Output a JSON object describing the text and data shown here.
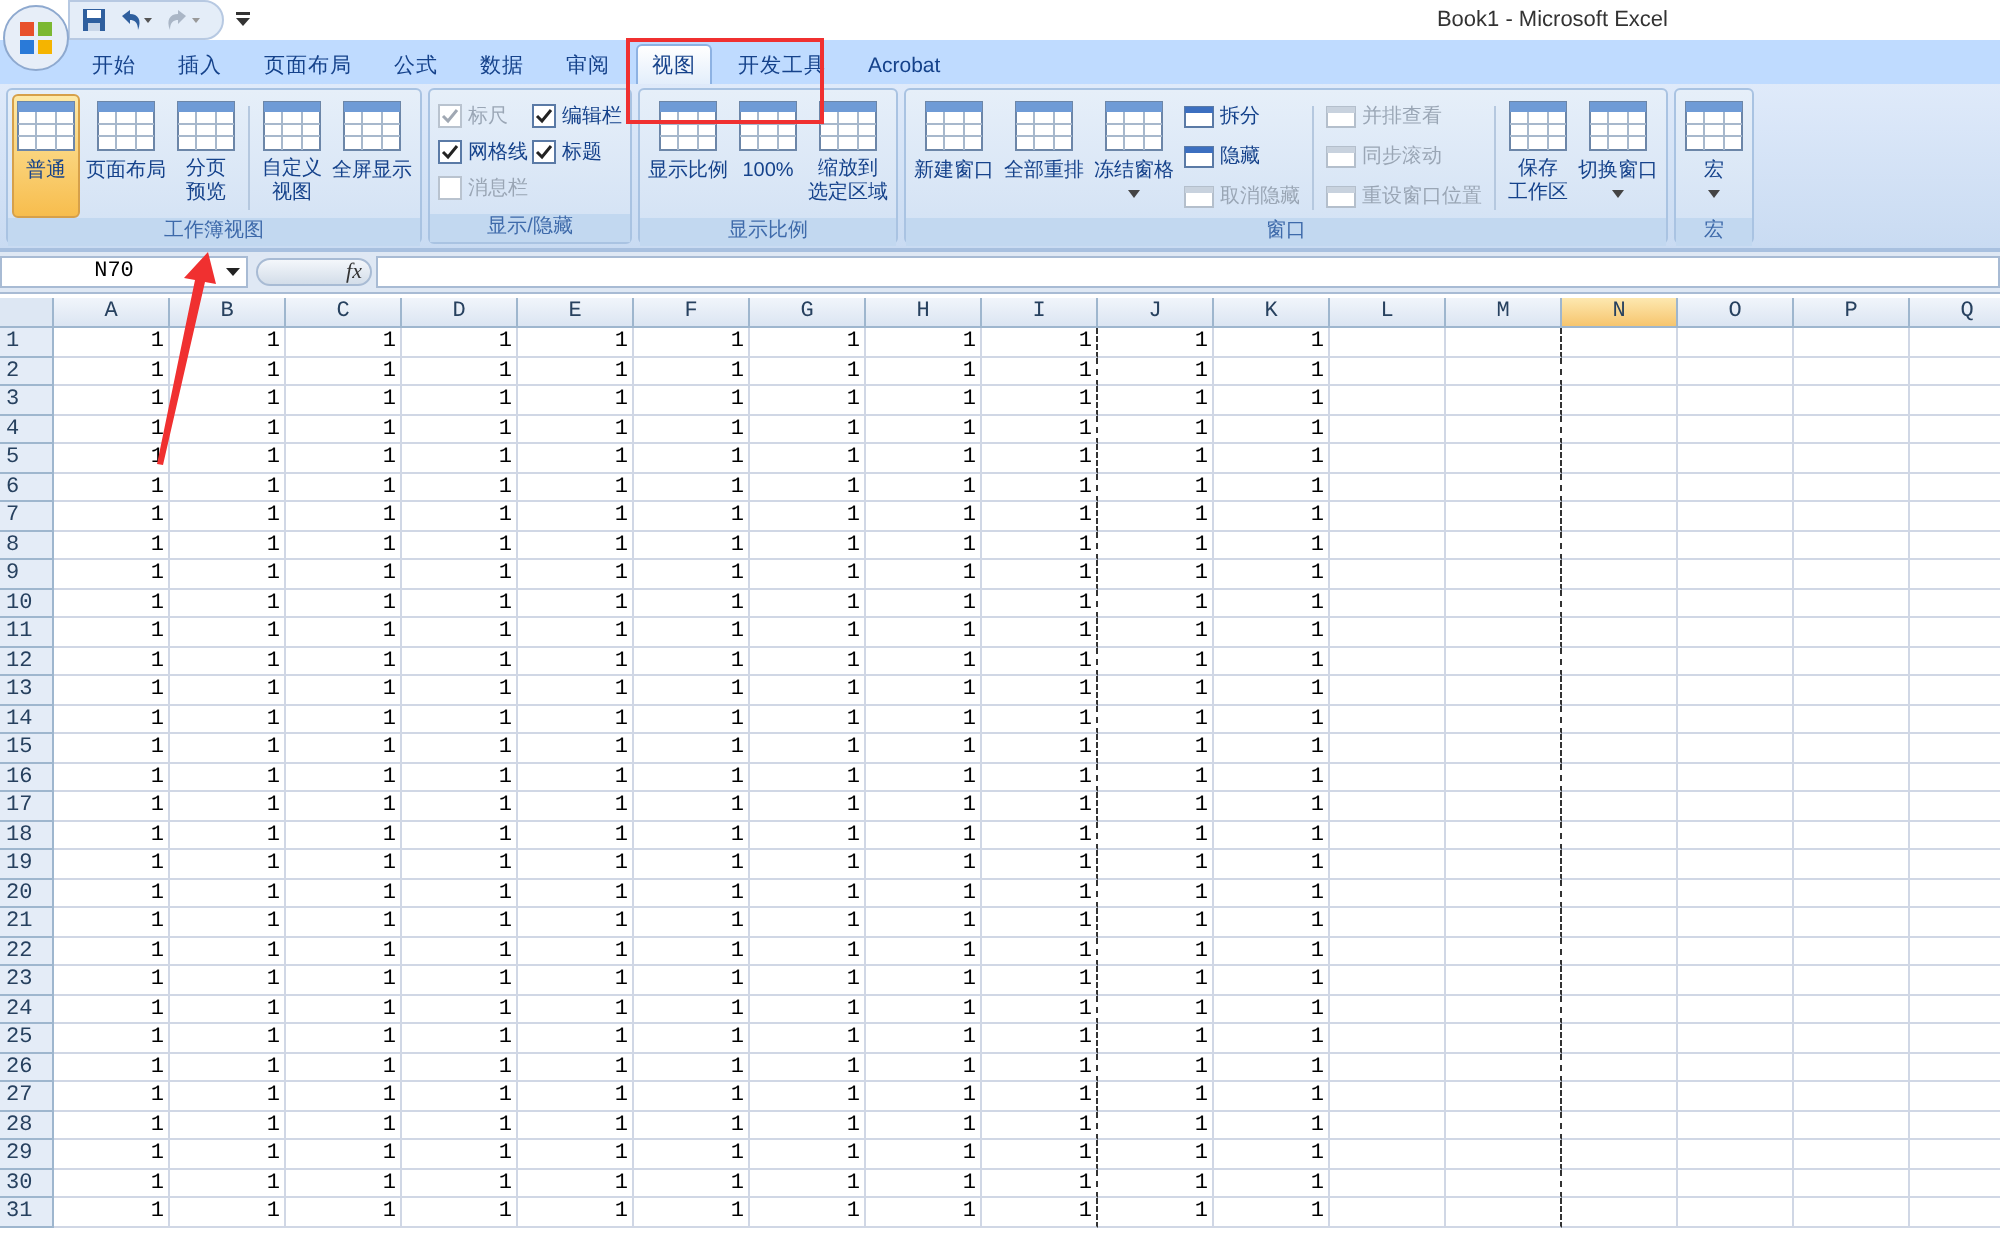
{
  "window": {
    "title": "Book1 - Microsoft Excel"
  },
  "tabs": [
    {
      "label": "开始",
      "selected": false
    },
    {
      "label": "插入",
      "selected": false
    },
    {
      "label": "页面布局",
      "selected": false
    },
    {
      "label": "公式",
      "selected": false
    },
    {
      "label": "数据",
      "selected": false
    },
    {
      "label": "审阅",
      "selected": false
    },
    {
      "label": "视图",
      "selected": true
    },
    {
      "label": "开发工具",
      "selected": false
    },
    {
      "label": "Acrobat",
      "selected": false
    }
  ],
  "ribbon_groups": [
    {
      "label": "工作簿视图",
      "items": [
        {
          "kind": "large",
          "label": "普通",
          "selected": true
        },
        {
          "kind": "large",
          "label": "页面布局",
          "selected": false
        },
        {
          "kind": "large",
          "lines": [
            "分页",
            "预览"
          ],
          "selected": false
        },
        {
          "kind": "separator"
        },
        {
          "kind": "large",
          "lines": [
            "自定义",
            "视图"
          ],
          "selected": false
        },
        {
          "kind": "large",
          "label": "全屏显示",
          "selected": false
        }
      ]
    },
    {
      "label": "显示/隐藏",
      "items": [
        {
          "kind": "checks",
          "checks": [
            {
              "label": "标尺",
              "checked": true,
              "disabled": true
            },
            {
              "label": "网格线",
              "checked": true,
              "disabled": false
            },
            {
              "label": "消息栏",
              "checked": false,
              "disabled": true
            },
            {
              "label": "编辑栏",
              "checked": true,
              "disabled": false
            },
            {
              "label": "标题",
              "checked": true,
              "disabled": false
            }
          ]
        }
      ]
    },
    {
      "label": "显示比例",
      "items": [
        {
          "kind": "large",
          "label": "显示比例",
          "selected": false
        },
        {
          "kind": "large",
          "label": "100%",
          "selected": false
        },
        {
          "kind": "large",
          "lines": [
            "缩放到",
            "选定区域"
          ],
          "selected": false
        }
      ]
    },
    {
      "label": "窗口",
      "items": [
        {
          "kind": "large",
          "label": "新建窗口",
          "selected": false
        },
        {
          "kind": "large",
          "label": "全部重排",
          "selected": false
        },
        {
          "kind": "large",
          "label": "冻结窗格",
          "selected": false,
          "dropdown": true
        },
        {
          "kind": "smalls",
          "buttons": [
            {
              "label": "拆分",
              "disabled": false
            },
            {
              "label": "隐藏",
              "disabled": false
            },
            {
              "label": "取消隐藏",
              "disabled": true
            }
          ]
        },
        {
          "kind": "separator"
        },
        {
          "kind": "smalls",
          "buttons": [
            {
              "label": "并排查看",
              "disabled": true
            },
            {
              "label": "同步滚动",
              "disabled": true
            },
            {
              "label": "重设窗口位置",
              "disabled": true
            }
          ]
        },
        {
          "kind": "separator"
        },
        {
          "kind": "large",
          "lines": [
            "保存",
            "工作区"
          ],
          "selected": false
        },
        {
          "kind": "large",
          "label": "切换窗口",
          "selected": false,
          "dropdown": true
        }
      ]
    },
    {
      "label": "宏",
      "items": [
        {
          "kind": "large",
          "label": "宏",
          "selected": false,
          "dropdown": true
        }
      ]
    }
  ],
  "formula_bar": {
    "name_box": "N70",
    "function_label": "fx"
  },
  "sheet": {
    "columns": [
      {
        "label": "A",
        "selected": false,
        "page_break_after": false
      },
      {
        "label": "B",
        "selected": false,
        "page_break_after": false
      },
      {
        "label": "C",
        "selected": false,
        "page_break_after": false
      },
      {
        "label": "D",
        "selected": false,
        "page_break_after": false
      },
      {
        "label": "E",
        "selected": false,
        "page_break_after": false
      },
      {
        "label": "F",
        "selected": false,
        "page_break_after": false
      },
      {
        "label": "G",
        "selected": false,
        "page_break_after": false
      },
      {
        "label": "H",
        "selected": false,
        "page_break_after": false
      },
      {
        "label": "I",
        "selected": false,
        "page_break_after": true
      },
      {
        "label": "J",
        "selected": false,
        "page_break_after": false
      },
      {
        "label": "K",
        "selected": false,
        "page_break_after": false
      },
      {
        "label": "L",
        "selected": false,
        "page_break_after": false
      },
      {
        "label": "M",
        "selected": false,
        "page_break_after": true
      },
      {
        "label": "N",
        "selected": true,
        "page_break_after": false
      },
      {
        "label": "O",
        "selected": false,
        "page_break_after": false
      },
      {
        "label": "P",
        "selected": false,
        "page_break_after": false
      },
      {
        "label": "Q",
        "selected": false
      }
    ],
    "rows": [
      {
        "label": "1",
        "cells": [
          "1",
          "1",
          "1",
          "1",
          "1",
          "1",
          "1",
          "1",
          "1",
          "1",
          "1"
        ]
      },
      {
        "label": "2",
        "cells": [
          "1",
          "1",
          "1",
          "1",
          "1",
          "1",
          "1",
          "1",
          "1",
          "1",
          "1"
        ]
      },
      {
        "label": "3",
        "cells": [
          "1",
          "1",
          "1",
          "1",
          "1",
          "1",
          "1",
          "1",
          "1",
          "1",
          "1"
        ]
      },
      {
        "label": "4",
        "cells": [
          "1",
          "1",
          "1",
          "1",
          "1",
          "1",
          "1",
          "1",
          "1",
          "1",
          "1"
        ]
      },
      {
        "label": "5",
        "cells": [
          "1",
          "1",
          "1",
          "1",
          "1",
          "1",
          "1",
          "1",
          "1",
          "1",
          "1"
        ]
      },
      {
        "label": "6",
        "cells": [
          "1",
          "1",
          "1",
          "1",
          "1",
          "1",
          "1",
          "1",
          "1",
          "1",
          "1"
        ]
      },
      {
        "label": "7",
        "cells": [
          "1",
          "1",
          "1",
          "1",
          "1",
          "1",
          "1",
          "1",
          "1",
          "1",
          "1"
        ]
      },
      {
        "label": "8",
        "cells": [
          "1",
          "1",
          "1",
          "1",
          "1",
          "1",
          "1",
          "1",
          "1",
          "1",
          "1"
        ]
      },
      {
        "label": "9",
        "cells": [
          "1",
          "1",
          "1",
          "1",
          "1",
          "1",
          "1",
          "1",
          "1",
          "1",
          "1"
        ]
      },
      {
        "label": "10",
        "cells": [
          "1",
          "1",
          "1",
          "1",
          "1",
          "1",
          "1",
          "1",
          "1",
          "1",
          "1"
        ]
      },
      {
        "label": "11",
        "cells": [
          "1",
          "1",
          "1",
          "1",
          "1",
          "1",
          "1",
          "1",
          "1",
          "1",
          "1"
        ]
      },
      {
        "label": "12",
        "cells": [
          "1",
          "1",
          "1",
          "1",
          "1",
          "1",
          "1",
          "1",
          "1",
          "1",
          "1"
        ]
      },
      {
        "label": "13",
        "cells": [
          "1",
          "1",
          "1",
          "1",
          "1",
          "1",
          "1",
          "1",
          "1",
          "1",
          "1"
        ]
      },
      {
        "label": "14",
        "cells": [
          "1",
          "1",
          "1",
          "1",
          "1",
          "1",
          "1",
          "1",
          "1",
          "1",
          "1"
        ]
      },
      {
        "label": "15",
        "cells": [
          "1",
          "1",
          "1",
          "1",
          "1",
          "1",
          "1",
          "1",
          "1",
          "1",
          "1"
        ]
      },
      {
        "label": "16",
        "cells": [
          "1",
          "1",
          "1",
          "1",
          "1",
          "1",
          "1",
          "1",
          "1",
          "1",
          "1"
        ]
      },
      {
        "label": "17",
        "cells": [
          "1",
          "1",
          "1",
          "1",
          "1",
          "1",
          "1",
          "1",
          "1",
          "1",
          "1"
        ]
      },
      {
        "label": "18",
        "cells": [
          "1",
          "1",
          "1",
          "1",
          "1",
          "1",
          "1",
          "1",
          "1",
          "1",
          "1"
        ]
      },
      {
        "label": "19",
        "cells": [
          "1",
          "1",
          "1",
          "1",
          "1",
          "1",
          "1",
          "1",
          "1",
          "1",
          "1"
        ]
      },
      {
        "label": "20",
        "cells": [
          "1",
          "1",
          "1",
          "1",
          "1",
          "1",
          "1",
          "1",
          "1",
          "1",
          "1"
        ]
      },
      {
        "label": "21",
        "cells": [
          "1",
          "1",
          "1",
          "1",
          "1",
          "1",
          "1",
          "1",
          "1",
          "1",
          "1"
        ]
      },
      {
        "label": "22",
        "cells": [
          "1",
          "1",
          "1",
          "1",
          "1",
          "1",
          "1",
          "1",
          "1",
          "1",
          "1"
        ]
      },
      {
        "label": "23",
        "cells": [
          "1",
          "1",
          "1",
          "1",
          "1",
          "1",
          "1",
          "1",
          "1",
          "1",
          "1"
        ]
      },
      {
        "label": "24",
        "cells": [
          "1",
          "1",
          "1",
          "1",
          "1",
          "1",
          "1",
          "1",
          "1",
          "1",
          "1"
        ]
      },
      {
        "label": "25",
        "cells": [
          "1",
          "1",
          "1",
          "1",
          "1",
          "1",
          "1",
          "1",
          "1",
          "1",
          "1"
        ]
      },
      {
        "label": "26",
        "cells": [
          "1",
          "1",
          "1",
          "1",
          "1",
          "1",
          "1",
          "1",
          "1",
          "1",
          "1"
        ]
      },
      {
        "label": "27",
        "cells": [
          "1",
          "1",
          "1",
          "1",
          "1",
          "1",
          "1",
          "1",
          "1",
          "1",
          "1"
        ]
      },
      {
        "label": "28",
        "cells": [
          "1",
          "1",
          "1",
          "1",
          "1",
          "1",
          "1",
          "1",
          "1",
          "1",
          "1"
        ]
      },
      {
        "label": "29",
        "cells": [
          "1",
          "1",
          "1",
          "1",
          "1",
          "1",
          "1",
          "1",
          "1",
          "1",
          "1"
        ]
      },
      {
        "label": "30",
        "cells": [
          "1",
          "1",
          "1",
          "1",
          "1",
          "1",
          "1",
          "1",
          "1",
          "1",
          "1"
        ]
      },
      {
        "label": "31",
        "cells": [
          "1",
          "1",
          "1",
          "1",
          "1",
          "1",
          "1",
          "1",
          "1",
          "1",
          "1"
        ]
      }
    ]
  }
}
